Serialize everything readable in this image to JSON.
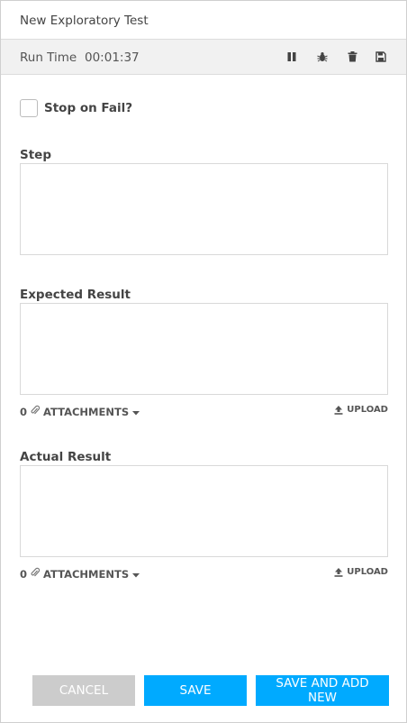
{
  "header": {
    "title": "New Exploratory Test"
  },
  "toolbar": {
    "runtime_label": "Run Time",
    "runtime_value": "00:01:37",
    "icons": [
      "pause-icon",
      "bug-icon",
      "trash-icon",
      "save-icon"
    ]
  },
  "form": {
    "stop_on_fail_label": "Stop on Fail?",
    "stop_on_fail_checked": false,
    "step_label": "Step",
    "expected_label": "Expected Result",
    "actual_label": "Actual Result",
    "expected_attachments": {
      "count": "0",
      "label": "ATTACHMENTS",
      "upload": "UPLOAD"
    },
    "actual_attachments": {
      "count": "0",
      "label": "ATTACHMENTS",
      "upload": "UPLOAD"
    }
  },
  "buttons": {
    "cancel": "CANCEL",
    "save": "SAVE",
    "save_and_add_new": "SAVE AND ADD NEW"
  },
  "colors": {
    "primary": "#00aaff",
    "cancel": "#cccccc",
    "toolbar_bg": "#f1f1f1"
  }
}
